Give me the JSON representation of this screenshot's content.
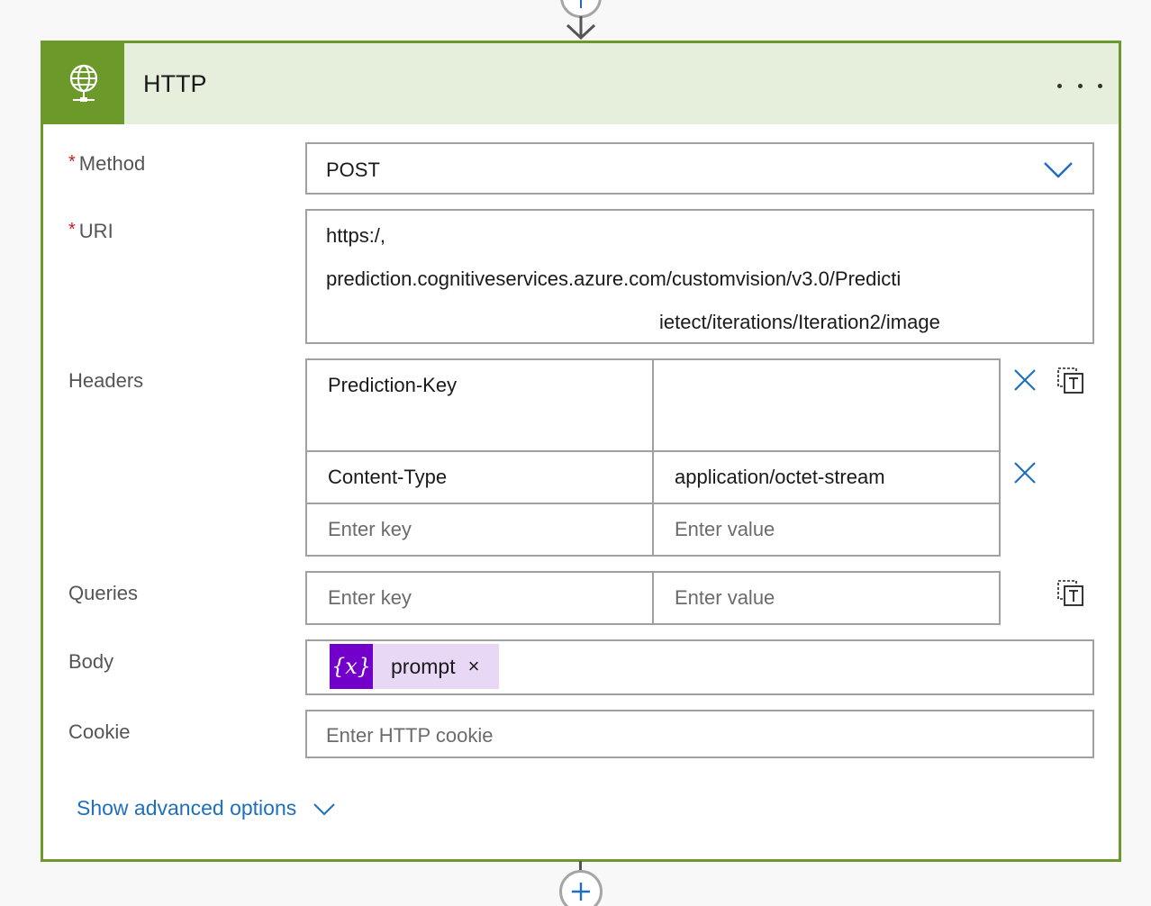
{
  "card": {
    "title": "HTTP",
    "icon": "globe-icon",
    "more_icon": "ellipsis-icon"
  },
  "labels": {
    "required_mark": "*",
    "method": "Method",
    "uri": "URI",
    "headers": "Headers",
    "queries": "Queries",
    "body": "Body",
    "cookie": "Cookie"
  },
  "method": {
    "value": "POST",
    "icon": "chevron-down-icon"
  },
  "uri": {
    "line1": "https:/,",
    "line2": "prediction.cognitiveservices.azure.com/customvision/v3.0/Predicti",
    "line3": "ietect/iterations/Iteration2/image"
  },
  "headers": {
    "rows": [
      {
        "key": "Prediction-Key",
        "value": ""
      },
      {
        "key": "Content-Type",
        "value": "application/octet-stream"
      }
    ],
    "key_placeholder": "Enter key",
    "value_placeholder": "Enter value",
    "remove_icon": "close-icon",
    "switch_icon": "switch-to-text-mode-icon"
  },
  "queries": {
    "key_placeholder": "Enter key",
    "value_placeholder": "Enter value",
    "switch_icon": "switch-to-text-mode-icon"
  },
  "body": {
    "token_symbol": "{x}",
    "token_label": "prompt",
    "token_remove": "×"
  },
  "cookie": {
    "placeholder": "Enter HTTP cookie"
  },
  "advanced": {
    "label": "Show advanced options",
    "icon": "chevron-down-icon"
  },
  "colors": {
    "accent_green": "#6b9a2b",
    "header_bg": "#e6efdc",
    "link_blue": "#1f6fbf",
    "token_purple": "#7200ca",
    "required_red": "#c41e1e"
  }
}
